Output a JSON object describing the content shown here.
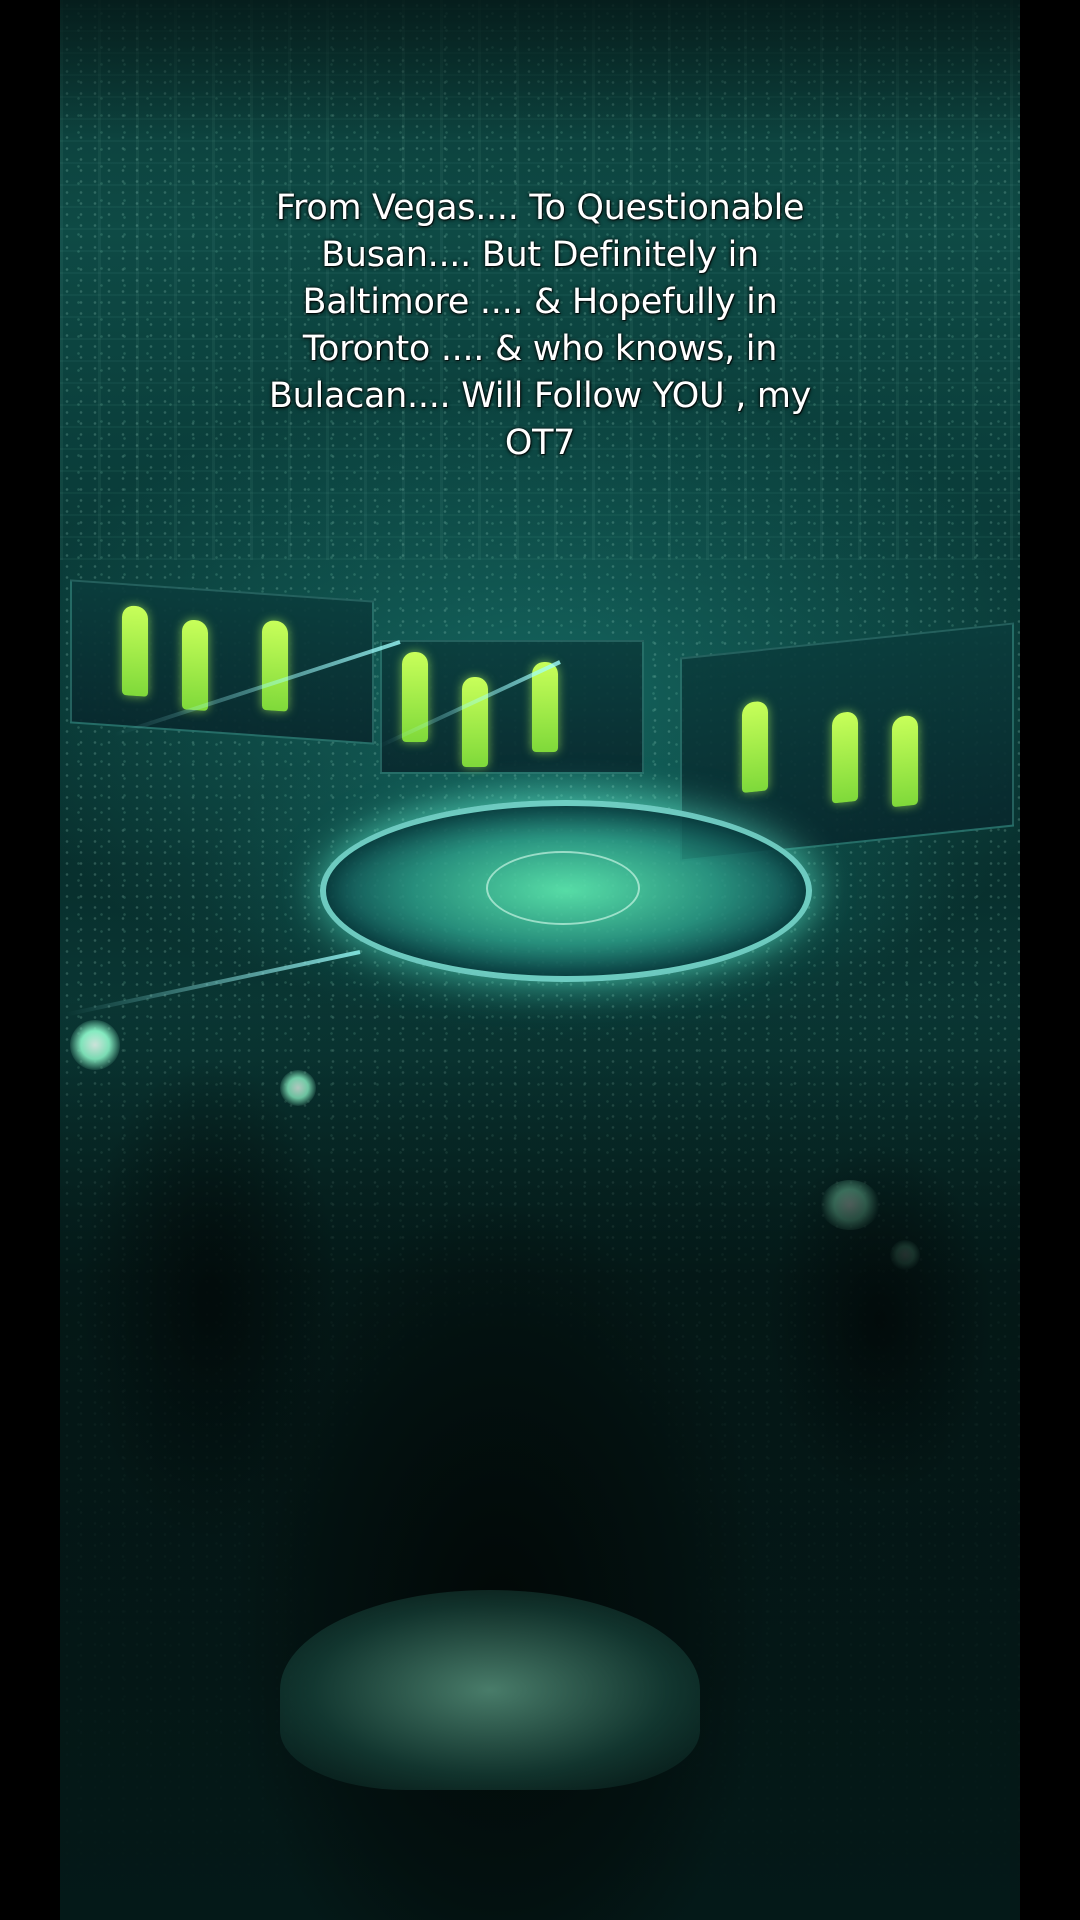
{
  "video": {
    "caption": "From Vegas.... To Questionable Busan.... But Definitely in Baltimore .... & Hopefully in Toronto .... & who knows, in Bulacan.... Will Follow YOU , my OT7"
  },
  "colors": {
    "letterbox": "#000000",
    "scene_tint": "#0a3d3a",
    "caption_text": "#ffffff"
  }
}
